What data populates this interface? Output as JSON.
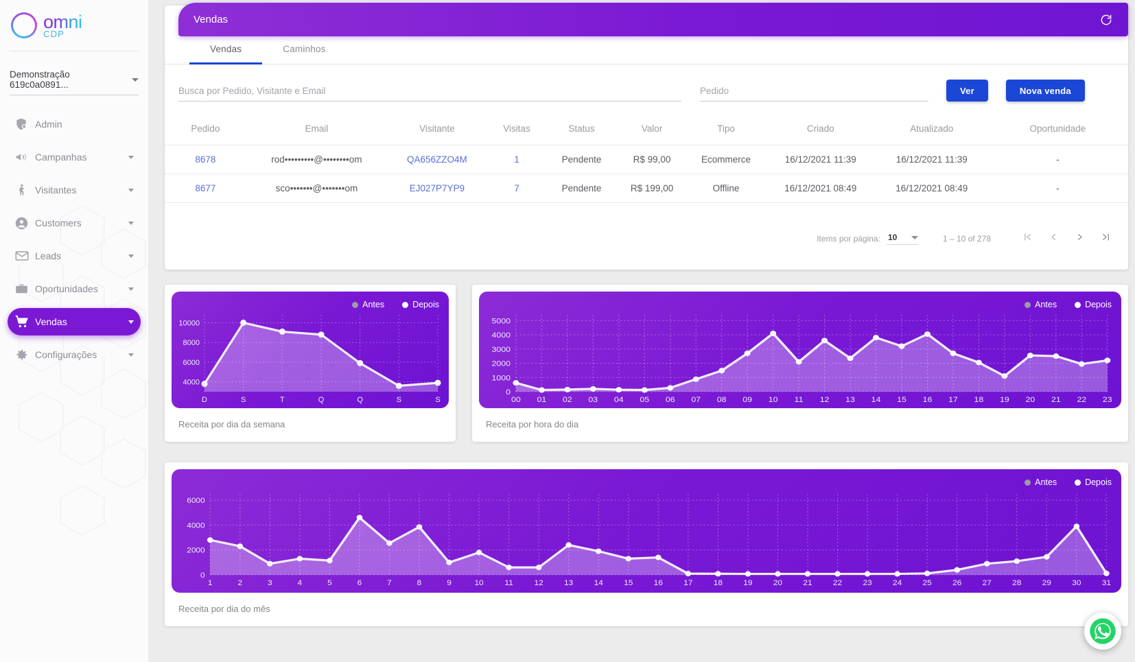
{
  "brand": {
    "name": "omni",
    "sub": "CDP"
  },
  "sidebar": {
    "account": "Demonstração 619c0a0891...",
    "items": [
      {
        "label": "Admin",
        "icon": "admin-shield-icon",
        "expandable": false
      },
      {
        "label": "Campanhas",
        "icon": "megaphone-icon",
        "expandable": true
      },
      {
        "label": "Visitantes",
        "icon": "person-walking-icon",
        "expandable": true
      },
      {
        "label": "Customers",
        "icon": "account-circle-icon",
        "expandable": true
      },
      {
        "label": "Leads",
        "icon": "envelope-icon",
        "expandable": true
      },
      {
        "label": "Oportunidades",
        "icon": "briefcase-icon",
        "expandable": true
      },
      {
        "label": "Vendas",
        "icon": "cart-icon",
        "expandable": true,
        "active": true
      },
      {
        "label": "Configurações",
        "icon": "gear-icon",
        "expandable": true
      }
    ]
  },
  "header": {
    "title": "Vendas",
    "refresh_icon": "refresh-icon"
  },
  "tabs": [
    {
      "label": "Vendas",
      "active": true
    },
    {
      "label": "Caminhos",
      "active": false
    }
  ],
  "filters": {
    "search_placeholder": "Busca por Pedido, Visitante e Email",
    "search_value": "",
    "pedido_placeholder": "Pedido",
    "pedido_value": "",
    "ver_label": "Ver",
    "nova_venda_label": "Nova venda"
  },
  "table": {
    "columns": [
      "Pedido",
      "Email",
      "Visitante",
      "Visitas",
      "Status",
      "Valor",
      "Tipo",
      "Criado",
      "Atualizado",
      "Oportunidade"
    ],
    "rows": [
      {
        "pedido": "8678",
        "email": "rod•••••••••@••••••••om",
        "visitante": "QA656ZZO4M",
        "visitas": "1",
        "status": "Pendente",
        "valor": "R$ 99,00",
        "tipo": "Ecommerce",
        "criado": "16/12/2021 11:39",
        "atualizado": "16/12/2021 11:39",
        "oportunidade": "-"
      },
      {
        "pedido": "8677",
        "email": "sco•••••••@•••••••om",
        "visitante": "EJ027P7YP9",
        "visitas": "7",
        "status": "Pendente",
        "valor": "R$ 199,00",
        "tipo": "Offline",
        "criado": "16/12/2021 08:49",
        "atualizado": "16/12/2021 08:49",
        "oportunidade": "-"
      }
    ]
  },
  "paginator": {
    "items_label": "Items por página:",
    "page_size": "10",
    "range": "1 – 10 of 278",
    "first_icon": "first-page-icon",
    "prev_icon": "prev-page-icon",
    "next_icon": "next-page-icon",
    "last_icon": "last-page-icon"
  },
  "legend": {
    "antes": "Antes",
    "depois": "Depois"
  },
  "captions": {
    "weekday": "Receita por dia da semana",
    "hour": "Receita por hora do dia",
    "monthday": "Receita por dia do mês"
  },
  "colors": {
    "purple": "#7a19d4",
    "purple_light": "#8c2bd6",
    "blue_button": "#1a47d6",
    "tab_indicator": "#1a47d6",
    "link": "#5a6fd8",
    "whatsapp_green": "#25D366"
  },
  "chart_data": [
    {
      "type": "area",
      "title": "Receita por dia da semana",
      "categories": [
        "D",
        "S",
        "T",
        "Q",
        "Q",
        "S",
        "S"
      ],
      "series": [
        {
          "name": "Depois",
          "values": [
            3800,
            10000,
            9100,
            8800,
            5900,
            3600,
            3900
          ]
        },
        {
          "name": "Antes",
          "values": []
        }
      ],
      "yticks": [
        4000,
        6000,
        8000,
        10000
      ],
      "ylim": [
        3000,
        10800
      ],
      "xlabel": "",
      "ylabel": "",
      "grid": true,
      "legend": "top-right"
    },
    {
      "type": "area",
      "title": "Receita por hora do dia",
      "categories": [
        "00",
        "01",
        "02",
        "03",
        "04",
        "05",
        "06",
        "07",
        "08",
        "09",
        "10",
        "11",
        "12",
        "13",
        "14",
        "15",
        "16",
        "17",
        "18",
        "19",
        "20",
        "21",
        "22",
        "23"
      ],
      "series": [
        {
          "name": "Depois",
          "values": [
            620,
            120,
            150,
            200,
            140,
            120,
            270,
            880,
            1480,
            2700,
            4100,
            2100,
            3600,
            2350,
            3800,
            3200,
            4050,
            2700,
            2050,
            1100,
            2550,
            2500,
            1950,
            2200
          ]
        },
        {
          "name": "Antes",
          "values": []
        }
      ],
      "yticks": [
        0,
        1000,
        2000,
        3000,
        4000,
        5000
      ],
      "ylim": [
        0,
        5400
      ],
      "xlabel": "",
      "ylabel": "",
      "grid": true,
      "legend": "top-right"
    },
    {
      "type": "area",
      "title": "Receita por dia do mês",
      "categories": [
        "1",
        "2",
        "3",
        "4",
        "5",
        "6",
        "7",
        "8",
        "9",
        "10",
        "11",
        "12",
        "13",
        "14",
        "15",
        "16",
        "17",
        "18",
        "19",
        "20",
        "21",
        "22",
        "23",
        "24",
        "25",
        "26",
        "27",
        "28",
        "29",
        "30",
        "31"
      ],
      "series": [
        {
          "name": "Depois",
          "values": [
            2800,
            2300,
            900,
            1300,
            1150,
            4600,
            2550,
            3850,
            1000,
            1800,
            600,
            600,
            2400,
            1900,
            1300,
            1400,
            100,
            90,
            80,
            80,
            80,
            80,
            80,
            80,
            120,
            400,
            900,
            1100,
            1450,
            3900,
            120
          ]
        },
        {
          "name": "Antes",
          "values": []
        }
      ],
      "yticks": [
        0,
        2000,
        4000,
        6000
      ],
      "ylim": [
        0,
        6500
      ],
      "xlabel": "",
      "ylabel": "",
      "grid": true,
      "legend": "top-right"
    }
  ],
  "whatsapp": {
    "icon": "whatsapp-icon"
  }
}
